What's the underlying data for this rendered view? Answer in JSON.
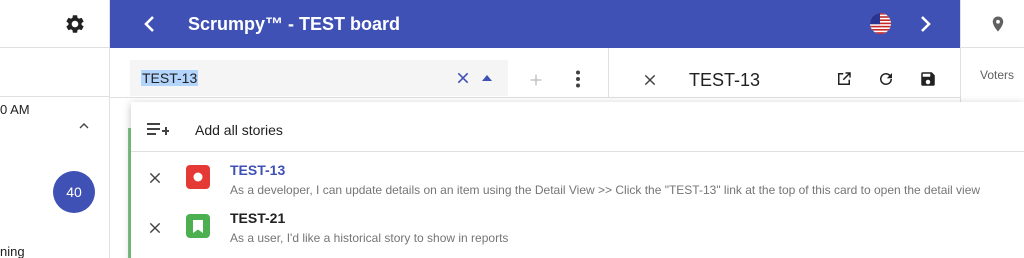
{
  "header": {
    "title": "Scrumpy™ - TEST board"
  },
  "left_panel": {
    "time_text": "0 AM",
    "badge": "40",
    "bottom_text": "ning"
  },
  "search": {
    "value": "TEST-13"
  },
  "card": {
    "key": "TEST-13"
  },
  "right_panel": {
    "voters_label": "Voters"
  },
  "dropdown": {
    "add_all_label": "Add all stories",
    "stories": [
      {
        "key": "TEST-13",
        "description": "As a developer, I can update details on an item using the Detail View >> Click the \"TEST-13\" link at the top of this card to open the detail view",
        "type_icon": "bug-icon",
        "type_color": "#e53935",
        "key_color": "#3f51b5"
      },
      {
        "key": "TEST-21",
        "description": "As a user, I'd like a historical story to show in reports",
        "type_icon": "story-icon",
        "type_color": "#4caf50",
        "key_color": "#212121"
      }
    ]
  },
  "colors": {
    "primary": "#3f51b5",
    "accent_green": "#81c784"
  }
}
